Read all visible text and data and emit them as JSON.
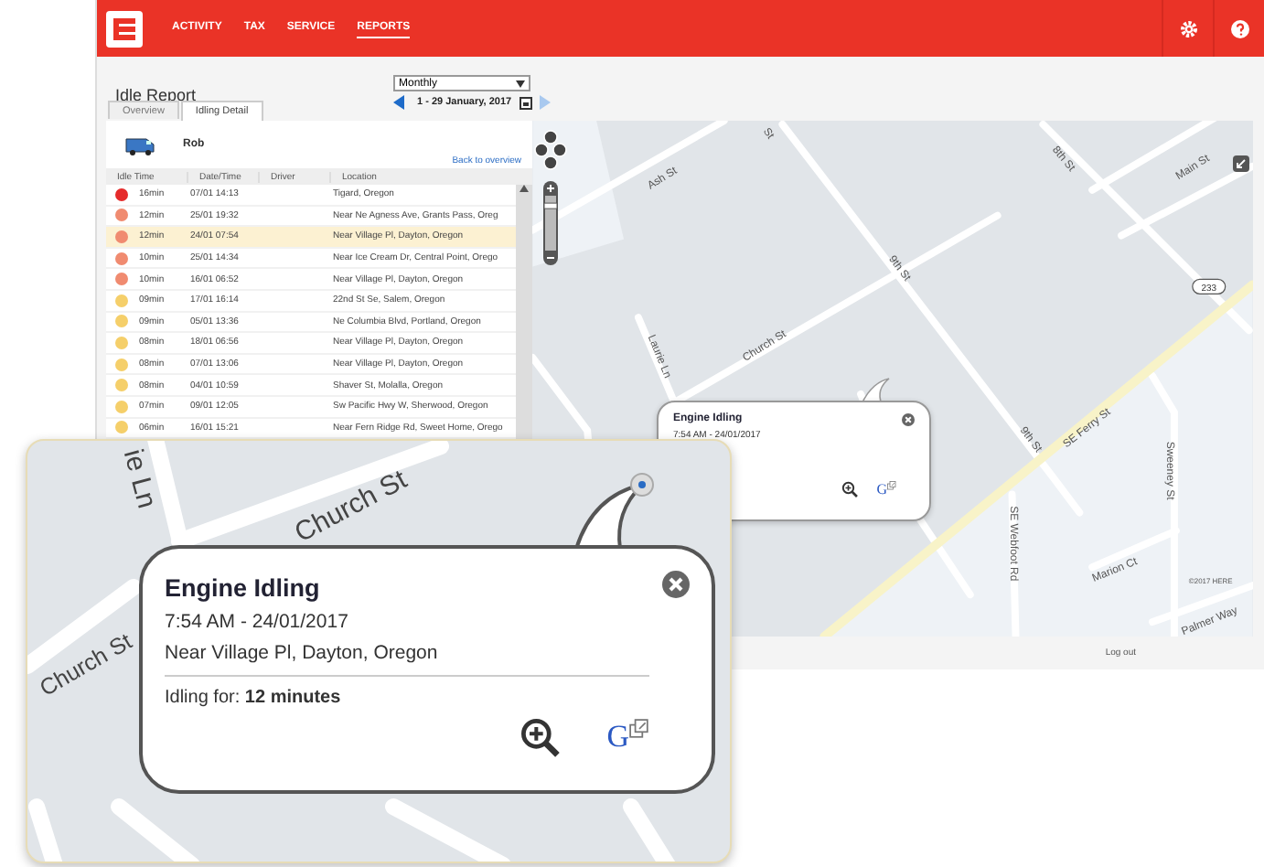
{
  "nav": {
    "items": [
      {
        "label": "ACTIVITY",
        "selected": false
      },
      {
        "label": "TAX",
        "selected": false
      },
      {
        "label": "SERVICE",
        "selected": false
      },
      {
        "label": "REPORTS",
        "selected": true
      }
    ]
  },
  "page_title": "Idle Report",
  "period": {
    "value": "Monthly",
    "range": "1 - 29 January, 2017"
  },
  "tabs": [
    {
      "label": "Overview",
      "selected": false
    },
    {
      "label": "Idling Detail",
      "selected": true
    }
  ],
  "vehicle": {
    "name": "Rob",
    "back_link": "Back to overview"
  },
  "table": {
    "columns": [
      "Idle Time",
      "Date/Time",
      "Driver",
      "Location"
    ],
    "rows": [
      {
        "idle": "16min",
        "date": "07/01 14:13",
        "location": "Tigard, Oregon",
        "color": "#e52b2b",
        "selected": false
      },
      {
        "idle": "12min",
        "date": "25/01 19:32",
        "location": "Near Ne Agness Ave, Grants Pass, Oreg",
        "color": "#f08b70",
        "selected": false
      },
      {
        "idle": "12min",
        "date": "24/01 07:54",
        "location": "Near Village Pl, Dayton, Oregon",
        "color": "#f08b70",
        "selected": true
      },
      {
        "idle": "10min",
        "date": "25/01 14:34",
        "location": "Near Ice Cream Dr, Central Point, Orego",
        "color": "#f08b70",
        "selected": false
      },
      {
        "idle": "10min",
        "date": "16/01 06:52",
        "location": "Near Village Pl, Dayton, Oregon",
        "color": "#f08b70",
        "selected": false
      },
      {
        "idle": "09min",
        "date": "17/01 16:14",
        "location": "22nd St Se, Salem, Oregon",
        "color": "#f5cf6a",
        "selected": false
      },
      {
        "idle": "09min",
        "date": "05/01 13:36",
        "location": "Ne Columbia Blvd, Portland, Oregon",
        "color": "#f5cf6a",
        "selected": false
      },
      {
        "idle": "08min",
        "date": "18/01 06:56",
        "location": "Near Village Pl, Dayton, Oregon",
        "color": "#f5cf6a",
        "selected": false
      },
      {
        "idle": "08min",
        "date": "07/01 13:06",
        "location": "Near Village Pl, Dayton, Oregon",
        "color": "#f5cf6a",
        "selected": false
      },
      {
        "idle": "08min",
        "date": "04/01 10:59",
        "location": "Shaver St, Molalla, Oregon",
        "color": "#f5cf6a",
        "selected": false
      },
      {
        "idle": "07min",
        "date": "09/01 12:05",
        "location": "Sw Pacific Hwy W, Sherwood, Oregon",
        "color": "#f5cf6a",
        "selected": false
      },
      {
        "idle": "06min",
        "date": "16/01 15:21",
        "location": "Near Fern Ridge Rd, Sweet Home, Orego",
        "color": "#f5cf6a",
        "selected": false
      }
    ]
  },
  "map": {
    "labels": [
      "Ash St",
      "St",
      "8th St",
      "Main St",
      "9th St",
      "Laurie Ln",
      "Church St",
      "9th St",
      "SE Ferry St",
      "SE Webfoot Rd",
      "Sweeney St",
      "Marion Ct",
      "Palmer Way"
    ],
    "zoom": {
      "level": 0.85
    },
    "route_shield": "233",
    "copyright": "©2017 HERE",
    "popup": {
      "title": "Engine Idling",
      "time": "7:54 AM - 24/01/2017",
      "actions": [
        {
          "kind": "zoom"
        },
        {
          "kind": "google",
          "label": "G"
        }
      ]
    }
  },
  "footer": {
    "logout": "Log out"
  },
  "inset": {
    "labels": [
      "ie Ln",
      "Church St",
      "Church St"
    ],
    "popup": {
      "title": "Engine Idling",
      "time": "7:54 AM - 24/01/2017",
      "location": "Near Village Pl, Dayton, Oregon",
      "idling": "Idling for: **12 minutes**",
      "actions": [
        {
          "kind": "zoom"
        },
        {
          "kind": "google",
          "label": "G"
        }
      ]
    }
  }
}
